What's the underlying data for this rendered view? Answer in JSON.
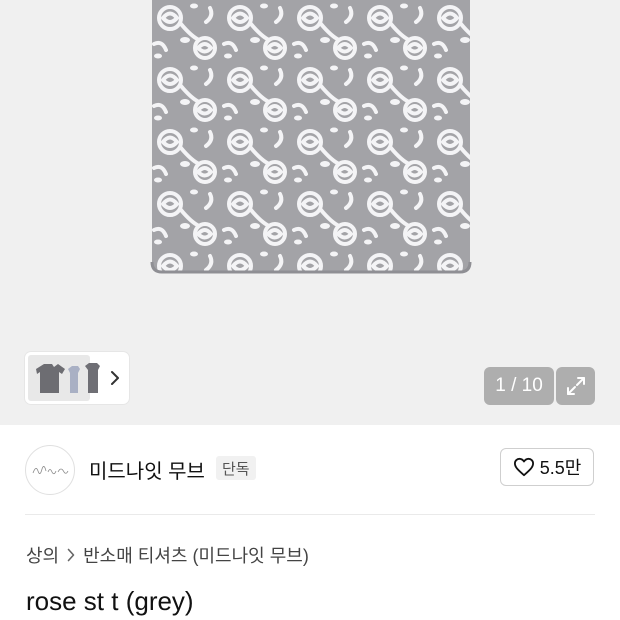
{
  "gallery": {
    "counter": "1 / 10",
    "colors": {
      "background": "#f0f0f0",
      "fabric": "#a3a3a7",
      "lace": "#f4f4f6"
    },
    "icons": {
      "next": "chevron-right-icon",
      "expand": "expand-icon"
    }
  },
  "brand": {
    "logo_text": "Midnight Move",
    "name": "미드나잇 무브",
    "badge": "단독",
    "likes": "5.5만",
    "icons": {
      "like": "heart-outline-icon"
    }
  },
  "breadcrumb": {
    "category": "상의",
    "subcategory": "반소매 티셔츠 (미드나잇 무브)"
  },
  "product": {
    "title": "rose st t (grey)"
  }
}
